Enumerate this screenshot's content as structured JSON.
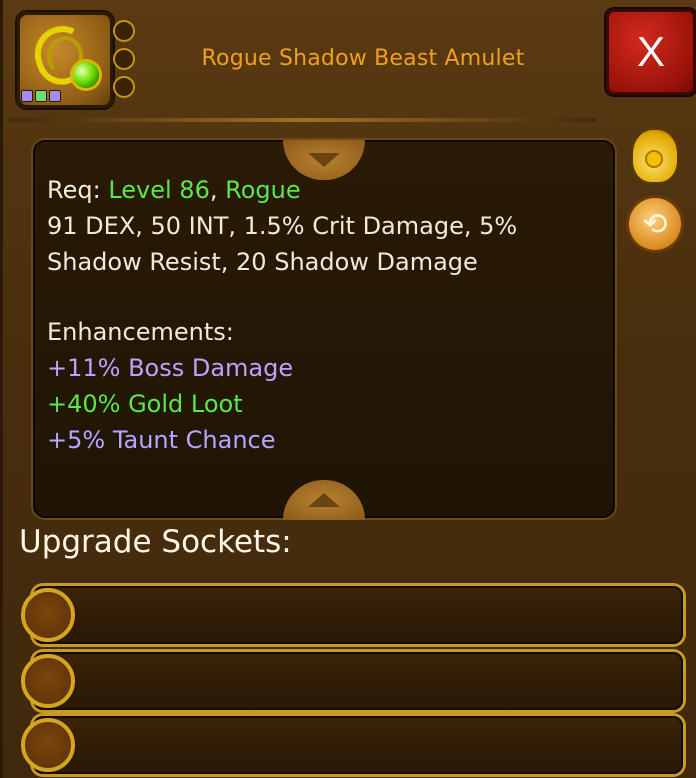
{
  "item": {
    "title": "Rogue Shadow Beast Amulet",
    "icon": "amulet-icon",
    "slot_colors": [
      "#a78bfa",
      "#6ee06e",
      "#a78bfa"
    ]
  },
  "close_button": {
    "label": "X",
    "icon": "close-icon"
  },
  "stats": {
    "req_label": "Req: ",
    "level": "Level 86",
    "separator": ", ",
    "class": "Rogue",
    "line1": "91 DEX, 50 INT, 1.5% Crit Damage, 5%",
    "line2": "Shadow Resist, 20 Shadow Damage",
    "enhancements_label": "Enhancements:",
    "enhancements": [
      {
        "text": "+11% Boss Damage",
        "color": "#b9a4ff"
      },
      {
        "text": "+40% Gold Loot",
        "color": "#5be64a"
      },
      {
        "text": "+5% Taunt Chance",
        "color": "#b9a4ff"
      }
    ]
  },
  "side_icons": {
    "sell": "gold-bag-icon",
    "swap": "swap-arrows-icon"
  },
  "upgrade_sockets": {
    "title": "Upgrade Sockets:",
    "count": 3
  },
  "colors": {
    "title": "#f0a020",
    "green": "#5be64a",
    "purple": "#b9a4ff",
    "text": "#f2ead8"
  }
}
